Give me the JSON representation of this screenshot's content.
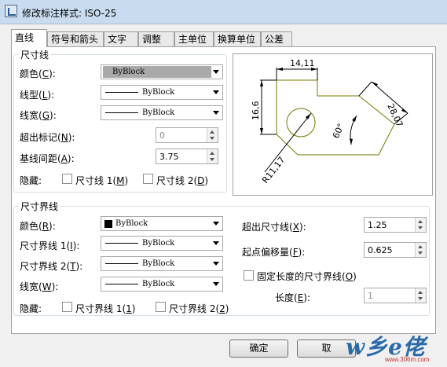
{
  "window": {
    "title": "修改标注样式: ISO-25"
  },
  "tabs": [
    "直线",
    "符号和箭头",
    "文字",
    "调整",
    "主单位",
    "换算单位",
    "公差"
  ],
  "dim_lines": {
    "title": "尺寸线",
    "color": {
      "label": "颜色",
      "key": "C",
      "value": "ByBlock"
    },
    "linetype": {
      "label": "线型",
      "key": "L",
      "value": "ByBlock"
    },
    "lineweight": {
      "label": "线宽",
      "key": "G",
      "value": "ByBlock"
    },
    "extend_beyond_ticks": {
      "label": "超出标记",
      "key": "N",
      "value": "0"
    },
    "baseline_spacing": {
      "label": "基线间距",
      "key": "A",
      "value": "3.75"
    },
    "suppress": {
      "label": "隐藏:",
      "opt1": "尺寸线 1",
      "key1": "M",
      "opt2": "尺寸线 2",
      "key2": "D"
    }
  },
  "ext_lines": {
    "title": "尺寸界线",
    "color": {
      "label": "颜色",
      "key": "R",
      "value": "ByBlock"
    },
    "linetype1": {
      "label": "尺寸界线 1",
      "key": "I",
      "value": "ByBlock"
    },
    "linetype2": {
      "label": "尺寸界线 2",
      "key": "T",
      "value": "ByBlock"
    },
    "lineweight": {
      "label": "线宽",
      "key": "W",
      "value": "ByBlock"
    },
    "suppress": {
      "label": "隐藏:",
      "opt1": "尺寸界线 1",
      "key1": "1",
      "opt2": "尺寸界线 2",
      "key2": "2"
    },
    "extend_beyond": {
      "label": "超出尺寸线",
      "key": "X",
      "value": "1.25"
    },
    "offset_origin": {
      "label": "起点偏移量",
      "key": "F",
      "value": "0.625"
    },
    "fixed_length": {
      "label": "固定长度的尺寸界线",
      "key": "O"
    },
    "length": {
      "label": "长度",
      "key": "E",
      "value": "1"
    }
  },
  "preview": {
    "dim_top": "14,11",
    "dim_left": "16,6",
    "dim_right": "28,07",
    "dim_angle": "60°",
    "dim_radius": "R11,17"
  },
  "buttons": {
    "ok": "确定",
    "cancel": "取"
  },
  "watermark": {
    "text": "w乡e佬",
    "url": "www.306m.com"
  },
  "colors": {
    "titlebar": "#c9dcef",
    "panel": "#ffffff",
    "group_border": "#d5dfe5",
    "shape_stroke": "#777700",
    "dim_stroke": "#000000"
  }
}
